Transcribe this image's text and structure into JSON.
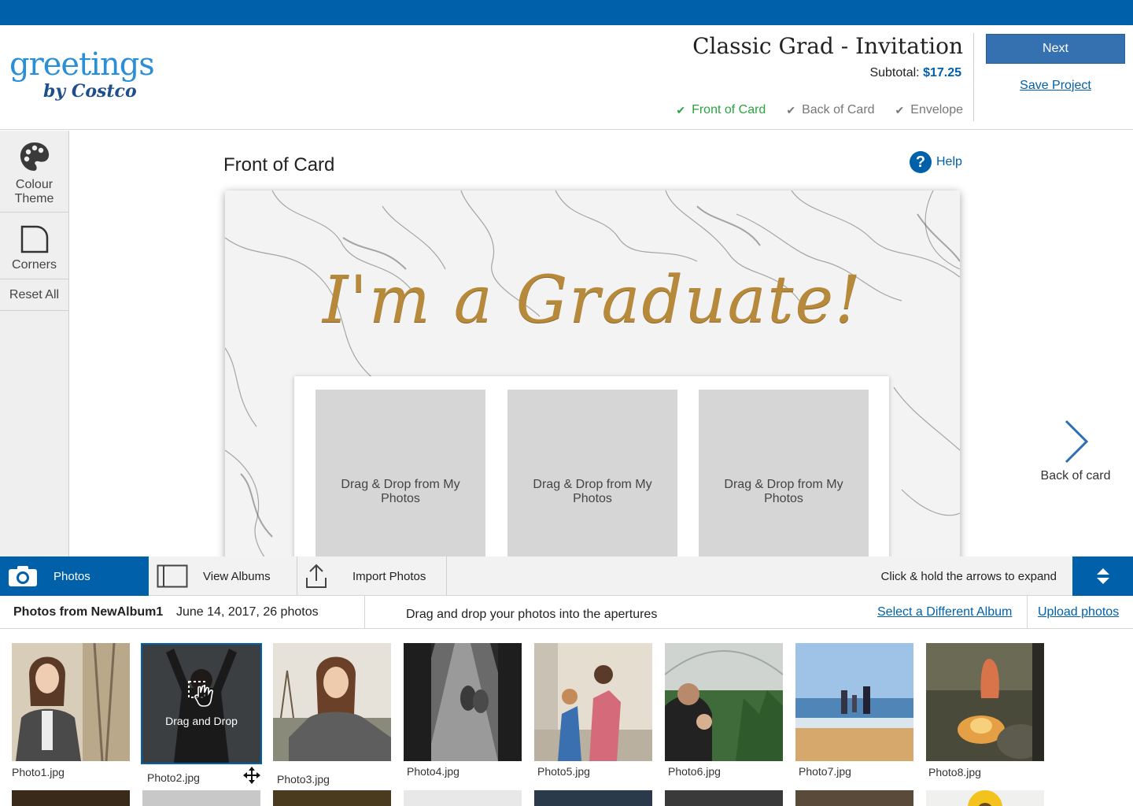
{
  "header": {
    "logo_line1": "greetings",
    "logo_line2": "by Costco",
    "title": "Classic Grad - Invitation",
    "subtotal_label": "Subtotal:",
    "subtotal_value": "$17.25",
    "steps": [
      {
        "label": "Front of Card",
        "active": true
      },
      {
        "label": "Back of Card",
        "active": false
      },
      {
        "label": "Envelope",
        "active": false
      }
    ],
    "next_label": "Next",
    "save_label": "Save Project"
  },
  "tools": {
    "colour_theme": "Colour\nTheme",
    "corners": "Corners",
    "reset_all": "Reset All"
  },
  "workspace": {
    "title": "Front of Card",
    "help_label": "Help",
    "card_headline": "I'm a Graduate!",
    "aperture_text": "Drag & Drop from My Photos",
    "back_nav_label": "Back of card"
  },
  "photo_tabs": {
    "photos": "Photos",
    "view_albums": "View Albums",
    "import_photos": "Import Photos",
    "expand_hint": "Click & hold the arrows to expand"
  },
  "album": {
    "name": "Photos from NewAlbum1",
    "meta": "June 14, 2017, 26 photos",
    "hint": "Drag and drop your photos into the apertures",
    "select_link": "Select a Different Album",
    "upload_link": "Upload photos"
  },
  "thumbnails": [
    {
      "caption": "Photo1.jpg"
    },
    {
      "caption": "Photo2.jpg",
      "overlay": "Drag and Drop"
    },
    {
      "caption": "Photo3.jpg"
    },
    {
      "caption": "Photo4.jpg"
    },
    {
      "caption": "Photo5.jpg"
    },
    {
      "caption": "Photo6.jpg"
    },
    {
      "caption": "Photo7.jpg"
    },
    {
      "caption": "Photo8.jpg"
    }
  ],
  "colors": {
    "brand_blue": "#0060a9",
    "active_step": "#2aa340",
    "gold": "#b68a3a"
  }
}
